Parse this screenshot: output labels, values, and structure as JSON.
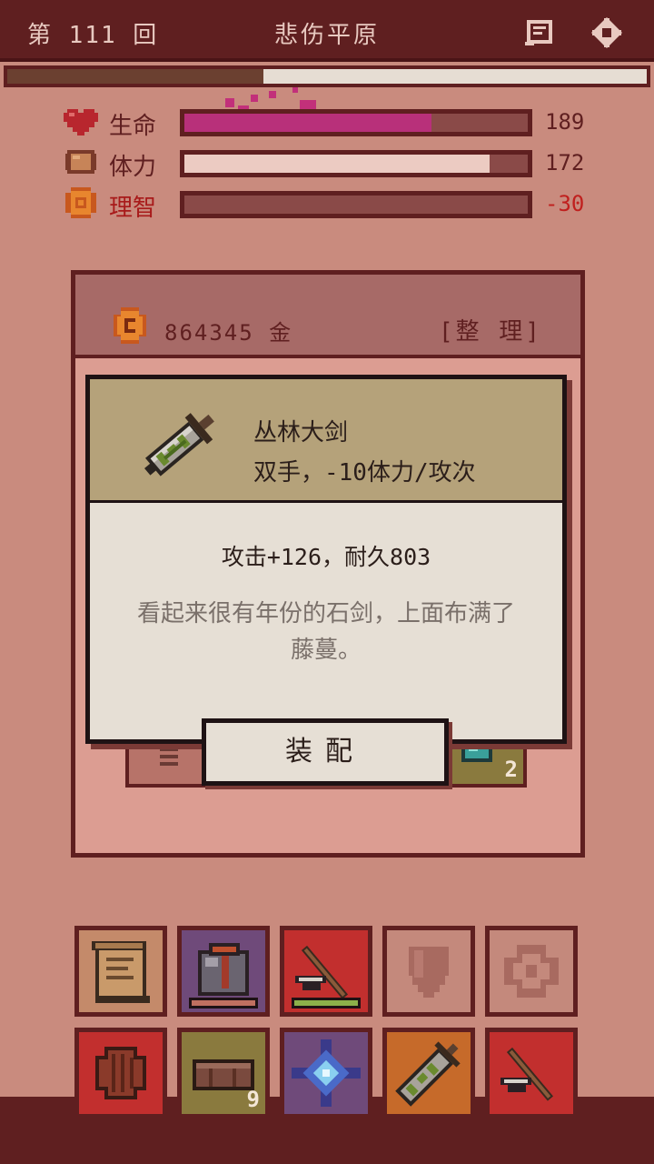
{
  "header": {
    "turn": "第 111 回",
    "location": "悲伤平原"
  },
  "progress": {
    "value": 0.4
  },
  "stats": [
    {
      "label": "生命",
      "value": "189",
      "fill": 0.72,
      "color": "#b8307a",
      "label_color": "#5f1f20",
      "value_color": "#5f1f20",
      "icon": "heart-icon"
    },
    {
      "label": "体力",
      "value": "172",
      "fill": 0.89,
      "color": "#eccbc2",
      "label_color": "#5f1f20",
      "value_color": "#5f1f20",
      "icon": "bread-icon"
    },
    {
      "label": "理智",
      "value": "-30",
      "fill": 0.0,
      "color": "#eccbc2",
      "label_color": "#a81a1a",
      "value_color": "#c0201e",
      "icon": "brain-coin-icon"
    }
  ],
  "inventory": {
    "gold": "864345 金",
    "sort_label": "[整 理]",
    "peek_count": "2"
  },
  "item_detail": {
    "name": "丛林大剑",
    "type": "双手，-10体力/攻次",
    "stats": "攻击+126，耐久803",
    "description": "看起来很有年份的石剑，上面布满了藤蔓。",
    "equip_label": "装配",
    "icon": "jungle-greatsword-icon"
  },
  "toolbar_row1": [
    {
      "icon": "scroll-icon",
      "bg": "#c48a6a",
      "strip": null
    },
    {
      "icon": "armor-icon",
      "bg": "#6f4a7a",
      "strip": "#c07060"
    },
    {
      "icon": "pickaxe-icon",
      "bg": "#c22f2e",
      "strip": "#8cb04a"
    },
    {
      "icon": "shield-empty-icon",
      "bg": "#c4897c",
      "strip": null
    },
    {
      "icon": "ring-empty-icon",
      "bg": "#c4897c",
      "strip": null
    }
  ],
  "toolbar_row2": [
    {
      "icon": "round-shield-icon",
      "bg": "#c22f2e",
      "count": ""
    },
    {
      "icon": "leather-roll-icon",
      "bg": "#8a7a3e",
      "count": "9"
    },
    {
      "icon": "crystal-icon",
      "bg": "#6f4a7a",
      "count": ""
    },
    {
      "icon": "jungle-sword-icon",
      "bg": "#c66a2a",
      "count": ""
    },
    {
      "icon": "pickaxe-icon",
      "bg": "#c22f2e",
      "count": ""
    }
  ]
}
